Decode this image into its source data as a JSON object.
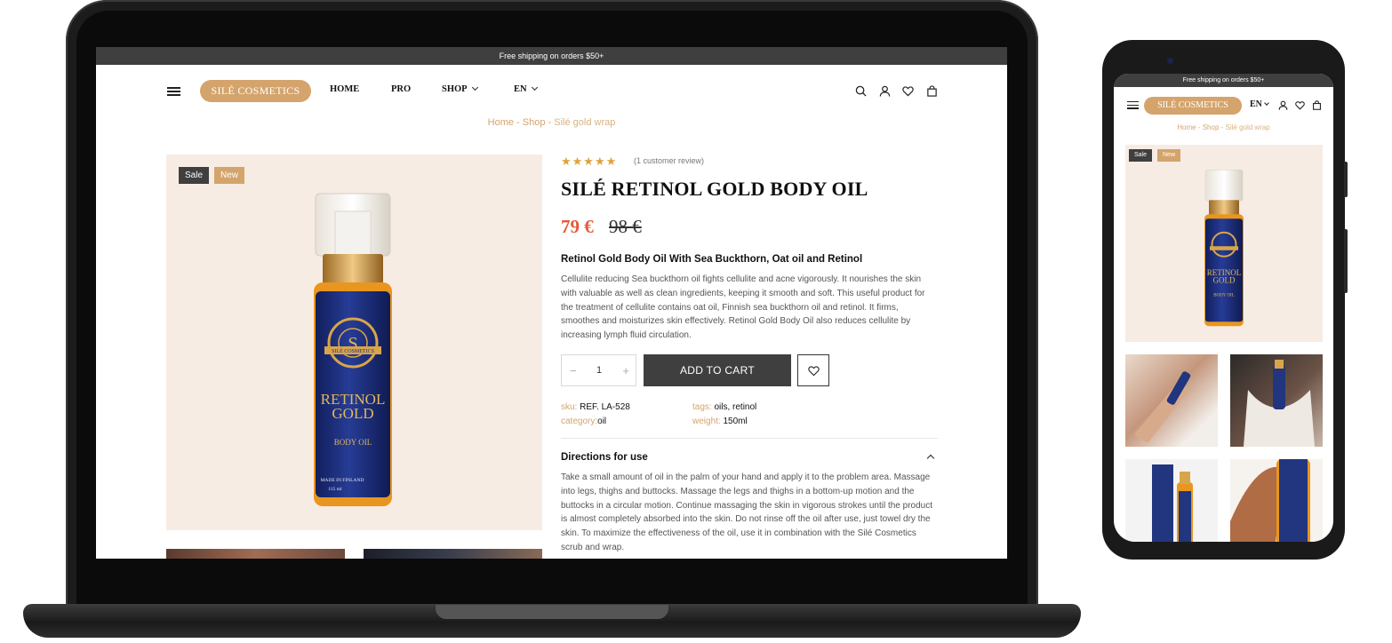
{
  "colors": {
    "accent_gold": "#d4a46c",
    "sale_red": "#e45a3a",
    "dark_bar": "#3f3f3f",
    "image_bg": "#f7ece3",
    "star": "#e0a23a"
  },
  "promo": {
    "text": "Free shipping on orders $50+"
  },
  "header": {
    "menu_icon": "hamburger-icon",
    "logo": "SILÉ COSMETICS",
    "nav": {
      "home": "HOME",
      "pro": "PRO",
      "shop": "SHOP",
      "lang": "EN"
    },
    "icons": [
      "search-icon",
      "user-icon",
      "heart-icon",
      "bag-icon"
    ]
  },
  "breadcrumb": {
    "home": "Home",
    "sep": " - ",
    "shop": "Shop",
    "current": "Silé gold wrap"
  },
  "product": {
    "badges": {
      "sale": "Sale",
      "new": "New"
    },
    "rating": {
      "stars": 5,
      "display": "★★★★★",
      "reviews": "(1  customer review)"
    },
    "title": "SILÉ RETINOL GOLD BODY OIL",
    "price": {
      "current": "79 €",
      "original": "98 €"
    },
    "subtitle": "Retinol Gold Body Oil With Sea Buckthorn, Oat oil and Retinol",
    "description": "Cellulite reducing Sea buckthorn oil fights cellulite and acne vigorously. It nourishes the skin with valuable as well as clean ingredients, keeping it smooth and soft. This useful product for the treatment of cellulite contains oat oil, Finnish sea buckthorn oil and retinol. It firms, smoothes and moisturizes skin effectively. Retinol Gold Body Oil also reduces cellulite by increasing lymph fluid circulation.",
    "quantity": {
      "minus": "−",
      "value": "1",
      "plus": "+"
    },
    "add_to_cart": "ADD TO CART",
    "meta": {
      "sku_label": "sku:",
      "sku_value": "REF. LA-528",
      "category_label": "category:",
      "category_value": "oil",
      "tags_label": "tags:",
      "tags_value": "oils, retinol",
      "weight_label": "weight:",
      "weight_value": "150ml"
    },
    "directions": {
      "title": "Directions for use",
      "body": "Take a small amount of oil in the palm of your hand and apply it to the problem area. Massage into legs, thighs and buttocks. Massage the legs and thighs in a bottom-up motion and the buttocks in a circular motion. Continue massaging the skin in vigorous strokes until the product is almost completely absorbed into the skin. Do not rinse off the oil after use, just towel dry the skin. To maximize the effectiveness of the oil, use it in combination with the Silé Cosmetics scrub and wrap."
    },
    "bottle_label": {
      "brand": "SILÉ COSMETICS",
      "line1": "RETINOL",
      "line2": "GOLD",
      "type": "BODY OIL",
      "origin": "MADE IN FINLAND",
      "volume": "115 ml"
    }
  },
  "mobile": {
    "promo": "Free shipping on orders $50+",
    "logo": "SILÉ COSMETICS",
    "lang": "EN",
    "breadcrumb": {
      "home": "Home",
      "sep": " - ",
      "shop": "Shop",
      "current": "Silé gold wrap"
    },
    "badges": {
      "sale": "Sale",
      "new": "New"
    }
  }
}
